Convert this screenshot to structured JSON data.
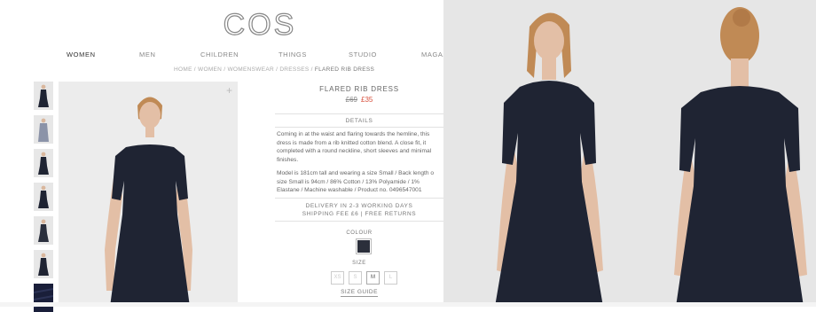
{
  "brand": {
    "logo_text": "COS"
  },
  "nav": {
    "items": [
      "WOMEN",
      "MEN",
      "CHILDREN",
      "THINGS",
      "STUDIO",
      "MAGAZ"
    ]
  },
  "breadcrumb": {
    "items": [
      "HOME",
      "WOMEN",
      "WOMENSWEAR",
      "DRESSES"
    ],
    "current": "FLARED RIB DRESS",
    "separator": " / "
  },
  "product": {
    "title": "FLARED RIB DRESS",
    "old_price": "£69",
    "sale_price": "£35",
    "details_heading": "DETAILS",
    "description_lines": [
      "Coming in at the waist and flaring towards the hemline, this",
      "dress is made from a rib knitted cotton blend. A close fit, it",
      "completed with a round neckline, short sleeves and minimal",
      "finishes."
    ],
    "spec_lines": [
      "Model is 181cm tall and wearing a size Small / Back length o",
      "size Small is 94cm / 86% Cotton / 13% Polyamide / 1%",
      "Elastane / Machine washable / Product no. 0496547001"
    ],
    "delivery": "DELIVERY IN 2-3 WORKING DAYS",
    "shipping": "SHIPPING FEE £6 | FREE RETURNS",
    "colour_label": "COLOUR",
    "colour_swatch": "#2b2f3b",
    "size_label": "SIZE",
    "sizes": [
      {
        "label": "XS",
        "available": false
      },
      {
        "label": "S",
        "available": false
      },
      {
        "label": "M",
        "available": true
      },
      {
        "label": "L",
        "available": false
      }
    ],
    "size_guide": "SIZE GUIDE"
  },
  "gallery": {
    "zoom_symbol": "+",
    "thumbnail_count": 7
  },
  "colors": {
    "dress": "#1f2433",
    "skin": "#e3bfa6",
    "hair": "#c08a55",
    "sale": "#d8503d"
  }
}
